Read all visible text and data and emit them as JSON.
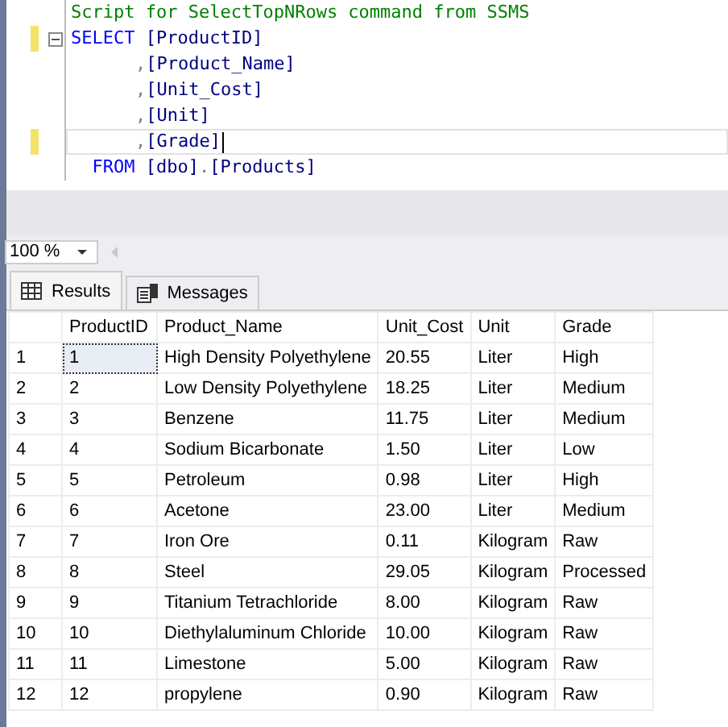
{
  "editor": {
    "lines": [
      {
        "changed": false,
        "current": false,
        "fold": false,
        "tokens": [
          {
            "kind": "comment",
            "text": "Script for SelectTopNRows command from SSMS"
          }
        ]
      },
      {
        "changed": true,
        "current": false,
        "fold": true,
        "tokens": [
          {
            "kind": "keyword",
            "text": "SELECT"
          },
          {
            "kind": "text",
            "text": " [ProductID]"
          }
        ]
      },
      {
        "changed": false,
        "current": false,
        "fold": false,
        "tokens": [
          {
            "kind": "indent"
          },
          {
            "kind": "punct",
            "text": ","
          },
          {
            "kind": "text",
            "text": "[Product_Name]"
          }
        ]
      },
      {
        "changed": false,
        "current": false,
        "fold": false,
        "tokens": [
          {
            "kind": "indent"
          },
          {
            "kind": "punct",
            "text": ","
          },
          {
            "kind": "text",
            "text": "[Unit_Cost]"
          }
        ]
      },
      {
        "changed": false,
        "current": false,
        "fold": false,
        "tokens": [
          {
            "kind": "indent"
          },
          {
            "kind": "punct",
            "text": ","
          },
          {
            "kind": "text",
            "text": "[Unit]"
          }
        ]
      },
      {
        "changed": true,
        "current": true,
        "fold": false,
        "tokens": [
          {
            "kind": "indent"
          },
          {
            "kind": "punct",
            "text": ","
          },
          {
            "kind": "text",
            "text": "[Grade]"
          }
        ]
      },
      {
        "changed": false,
        "current": false,
        "fold": false,
        "tokens": [
          {
            "kind": "keyword",
            "text": "  FROM"
          },
          {
            "kind": "text",
            "text": " [dbo]"
          },
          {
            "kind": "punct",
            "text": "."
          },
          {
            "kind": "text",
            "text": "[Products]"
          }
        ]
      }
    ]
  },
  "zoom": {
    "value": "100 %"
  },
  "tabs": [
    {
      "label": "Results",
      "kind": "grid",
      "selected": true
    },
    {
      "label": "Messages",
      "kind": "messages",
      "selected": false
    }
  ],
  "table": {
    "columns": [
      "ProductID",
      "Product_Name",
      "Unit_Cost",
      "Unit",
      "Grade"
    ],
    "rows": [
      {
        "number": "1",
        "selected": true,
        "cells": [
          "1",
          "High Density Polyethylene",
          "20.55",
          "Liter",
          "High"
        ]
      },
      {
        "number": "2",
        "selected": false,
        "cells": [
          "2",
          "Low Density Polyethylene",
          "18.25",
          "Liter",
          "Medium"
        ]
      },
      {
        "number": "3",
        "selected": false,
        "cells": [
          "3",
          "Benzene",
          "11.75",
          "Liter",
          "Medium"
        ]
      },
      {
        "number": "4",
        "selected": false,
        "cells": [
          "4",
          "Sodium Bicarbonate",
          "1.50",
          "Liter",
          "Low"
        ]
      },
      {
        "number": "5",
        "selected": false,
        "cells": [
          "5",
          "Petroleum",
          "0.98",
          "Liter",
          "High"
        ]
      },
      {
        "number": "6",
        "selected": false,
        "cells": [
          "6",
          "Acetone",
          "23.00",
          "Liter",
          "Medium"
        ]
      },
      {
        "number": "7",
        "selected": false,
        "cells": [
          "7",
          "Iron Ore",
          "0.11",
          "Kilogram",
          "Raw"
        ]
      },
      {
        "number": "8",
        "selected": false,
        "cells": [
          "8",
          "Steel",
          "29.05",
          "Kilogram",
          "Processed"
        ]
      },
      {
        "number": "9",
        "selected": false,
        "cells": [
          "9",
          "Titanium Tetrachloride",
          "8.00",
          "Kilogram",
          "Raw"
        ]
      },
      {
        "number": "10",
        "selected": false,
        "cells": [
          "10",
          "Diethylaluminum Chloride",
          "10.00",
          "Kilogram",
          "Raw"
        ]
      },
      {
        "number": "11",
        "selected": false,
        "cells": [
          "11",
          "Limestone",
          "5.00",
          "Kilogram",
          "Raw"
        ]
      },
      {
        "number": "12",
        "selected": false,
        "cells": [
          "12",
          "propylene",
          "0.90",
          "Kilogram",
          "Raw"
        ]
      }
    ]
  }
}
